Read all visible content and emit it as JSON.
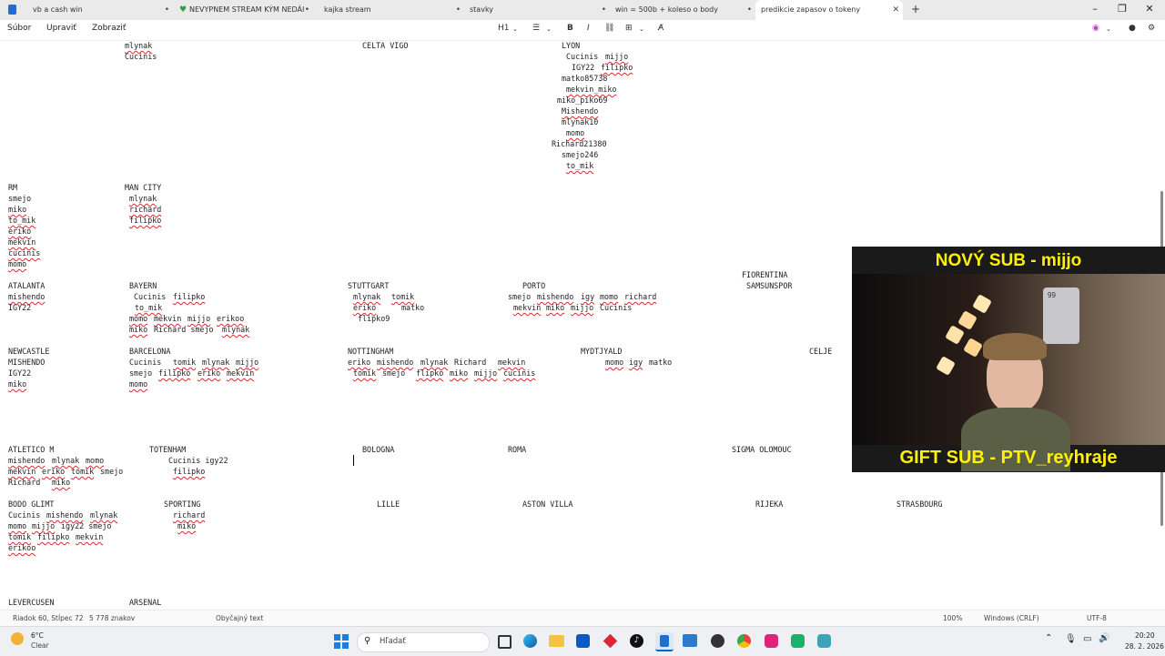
{
  "tabs": [
    {
      "label": "vb a cash  win"
    },
    {
      "label": "NEVYPNEM STREAM KÝM NEDÁI"
    },
    {
      "label": "kajka stream"
    },
    {
      "label": "stavky"
    },
    {
      "label": "win = 500b + koleso o body"
    },
    {
      "label": "predikcie zapasov o tokeny",
      "active": true
    }
  ],
  "new_tab": "+",
  "menu": {
    "file": "Súbor",
    "edit": "Upraviť",
    "view": "Zobraziť",
    "heading": "H1"
  },
  "doc": {
    "lines": [
      [
        [
          137,
          50,
          "mlynak",
          1
        ],
        [
          398,
          50,
          "CELTA VIGO"
        ],
        [
          617,
          50,
          "LYON"
        ]
      ],
      [
        [
          137,
          62,
          "Cucinis"
        ],
        [
          622,
          62,
          "Cucinis "
        ],
        [
          665,
          62,
          "mijjo",
          1
        ]
      ],
      [
        [
          628,
          74,
          "IGY22 "
        ],
        [
          660,
          74,
          "filipko",
          1
        ]
      ],
      [
        [
          617,
          86,
          "matko85738"
        ]
      ],
      [
        [
          622,
          98,
          "mekvin_miko",
          1
        ]
      ],
      [
        [
          612,
          110,
          "miko_piko69"
        ]
      ],
      [
        [
          617,
          122,
          "Mishendo",
          1
        ]
      ],
      [
        [
          617,
          134,
          "mlynak10"
        ]
      ],
      [
        [
          622,
          146,
          "momo",
          1
        ]
      ],
      [
        [
          606,
          158,
          "Richard21380"
        ]
      ],
      [
        [
          617,
          170,
          "smejo246"
        ]
      ],
      [
        [
          622,
          182,
          "to_mik",
          1
        ]
      ],
      [
        [
          9,
          206,
          "RM"
        ],
        [
          137,
          206,
          "MAN CITY"
        ]
      ],
      [
        [
          9,
          218,
          "smejo"
        ],
        [
          142,
          218,
          "mlynak",
          1
        ]
      ],
      [
        [
          9,
          230,
          "miko",
          1
        ],
        [
          142,
          230,
          "richard",
          1
        ]
      ],
      [
        [
          9,
          242,
          "to_mik",
          1
        ],
        [
          142,
          242,
          "filipko",
          1
        ]
      ],
      [
        [
          9,
          254,
          "eriko",
          1
        ]
      ],
      [
        [
          9,
          266,
          "mekvin",
          1
        ]
      ],
      [
        [
          9,
          278,
          "cucinis",
          1
        ]
      ],
      [
        [
          9,
          290,
          "momo",
          1
        ]
      ],
      [
        [
          815,
          302,
          "FIORENTINA"
        ]
      ],
      [
        [
          9,
          314,
          "ATALANTA"
        ],
        [
          142,
          314,
          "BAYERN"
        ],
        [
          382,
          314,
          "STUTTGART"
        ],
        [
          574,
          314,
          "PORTO"
        ],
        [
          820,
          314,
          "SAMSUNSPOR"
        ]
      ],
      [
        [
          9,
          326,
          "mishendo",
          1
        ],
        [
          147,
          326,
          "Cucinis "
        ],
        [
          190,
          326,
          "filipko",
          1
        ],
        [
          388,
          326,
          "mlynak",
          1
        ],
        [
          430,
          326,
          "tomik",
          1
        ],
        [
          558,
          326,
          "smejo "
        ],
        [
          590,
          326,
          "mishendo",
          1
        ],
        [
          638,
          326,
          "igy",
          1
        ],
        [
          659,
          326,
          "momo",
          1
        ],
        [
          686,
          326,
          "richard",
          1
        ]
      ],
      [
        [
          9,
          338,
          "IGY22"
        ],
        [
          148,
          338,
          "to_mik",
          1
        ],
        [
          388,
          338,
          "eriko",
          1
        ],
        [
          441,
          338,
          "matko"
        ],
        [
          564,
          338,
          "mekvin",
          1
        ],
        [
          600,
          338,
          "miko",
          1
        ],
        [
          627,
          338,
          "mijjo",
          1
        ],
        [
          659,
          338,
          "Cucinis"
        ]
      ],
      [
        [
          142,
          350,
          "momo",
          1
        ],
        [
          169,
          350,
          "mekvin",
          1
        ],
        [
          206,
          350,
          "mijjo",
          1
        ],
        [
          238,
          350,
          "erikoo",
          1
        ],
        [
          393,
          350,
          "flipko9"
        ]
      ],
      [
        [
          142,
          362,
          "miko",
          1
        ],
        [
          169,
          362,
          "Richard smejo "
        ],
        [
          244,
          362,
          "mlynak",
          1
        ]
      ],
      [
        [
          9,
          386,
          "NEWCASTLE"
        ],
        [
          142,
          386,
          "BARCELONA"
        ],
        [
          382,
          386,
          "NOTTINGHAM"
        ],
        [
          638,
          386,
          "MYDTJYALD"
        ],
        [
          889,
          386,
          "CELJE"
        ]
      ],
      [
        [
          9,
          398,
          "MISHENDO"
        ],
        [
          142,
          398,
          "Cucinis  "
        ],
        [
          190,
          398,
          "tomik",
          1
        ],
        [
          222,
          398,
          "mlynak",
          1
        ],
        [
          259,
          398,
          "mijjo",
          1
        ],
        [
          382,
          398,
          "eriko",
          1
        ],
        [
          414,
          398,
          "mishendo",
          1
        ],
        [
          462,
          398,
          "mlynak",
          1
        ],
        [
          499,
          398,
          "Richard "
        ],
        [
          547,
          398,
          "mekvin",
          1
        ],
        [
          665,
          398,
          "momo",
          1
        ],
        [
          691,
          398,
          "igy",
          1
        ],
        [
          713,
          398,
          "matko"
        ]
      ],
      [
        [
          9,
          410,
          "IGY22"
        ],
        [
          142,
          410,
          "smejo "
        ],
        [
          174,
          410,
          "filipko",
          1
        ],
        [
          217,
          410,
          "eriko",
          1
        ],
        [
          249,
          410,
          "mekvin",
          1
        ],
        [
          388,
          410,
          "tomik",
          1
        ],
        [
          420,
          410,
          "smejo "
        ],
        [
          457,
          410,
          "flipko",
          1
        ],
        [
          494,
          410,
          "miko",
          1
        ],
        [
          521,
          410,
          "mijjo",
          1
        ],
        [
          553,
          410,
          "cucinis",
          1
        ]
      ],
      [
        [
          9,
          422,
          "miko",
          1
        ],
        [
          142,
          422,
          "momo",
          1
        ]
      ],
      [
        [
          9,
          494,
          "ATLETICO M"
        ],
        [
          164,
          494,
          "TOTENHAM"
        ],
        [
          398,
          494,
          "BOLOGNA"
        ],
        [
          558,
          494,
          "ROMA"
        ],
        [
          804,
          494,
          "SIGMA OLOMOUC"
        ]
      ],
      [
        [
          9,
          506,
          "mishendo",
          1
        ],
        [
          57,
          506,
          "mlynak",
          1
        ],
        [
          94,
          506,
          "momo",
          1
        ],
        [
          185,
          506,
          "Cucinis igy22"
        ]
      ],
      [
        [
          9,
          518,
          "mekvin",
          1
        ],
        [
          46,
          518,
          "eriko",
          1
        ],
        [
          78,
          518,
          "tomik",
          1
        ],
        [
          110,
          518,
          "smejo"
        ],
        [
          190,
          518,
          "filipko",
          1
        ]
      ],
      [
        [
          9,
          530,
          "Richard  "
        ],
        [
          57,
          530,
          "miko",
          1
        ]
      ],
      [
        [
          9,
          554,
          "BODO GLIMT"
        ],
        [
          180,
          554,
          "SPORTING"
        ],
        [
          414,
          554,
          "LILLE"
        ],
        [
          574,
          554,
          "ASTON VILLA"
        ],
        [
          830,
          554,
          "RIJEKA"
        ],
        [
          985,
          554,
          "STRASBOURG"
        ]
      ],
      [
        [
          9,
          566,
          "Cucinis "
        ],
        [
          51,
          566,
          "mishendo",
          1
        ],
        [
          99,
          566,
          "mlynak",
          1
        ],
        [
          190,
          566,
          "richard",
          1
        ]
      ],
      [
        [
          9,
          578,
          "momo",
          1
        ],
        [
          35,
          578,
          "mijjo",
          1
        ],
        [
          67,
          578,
          "igy22 smejo"
        ],
        [
          195,
          578,
          "miko",
          1
        ]
      ],
      [
        [
          9,
          590,
          "tomik",
          1
        ],
        [
          41,
          590,
          "filipko",
          1
        ],
        [
          83,
          590,
          "mekvin",
          1
        ]
      ],
      [
        [
          9,
          602,
          "erikoo",
          1
        ]
      ],
      [
        [
          9,
          662,
          "LEVERCUSEN"
        ],
        [
          142,
          662,
          "ARSENAL"
        ]
      ]
    ]
  },
  "status": {
    "position": "Riadok 60, Stĺpec 72",
    "chars": "5 778 znakov",
    "format": "Obyčajný text",
    "zoom": "100%",
    "eol": "Windows (CRLF)",
    "encoding": "UTF-8"
  },
  "stream": {
    "top_banner": "NOVÝ SUB - mijjo",
    "bottom_banner": "GIFT SUB - PTV_reyhraje",
    "card_rating": "99"
  },
  "taskbar": {
    "weather_temp": "6°C",
    "weather_desc": "Clear",
    "search_placeholder": "Hľadať",
    "time": "20:20",
    "date": "28. 2. 2026"
  },
  "colors": {
    "accent": "#0067c0",
    "banner_text": "#fff200",
    "spell_underline": "#d03030"
  }
}
